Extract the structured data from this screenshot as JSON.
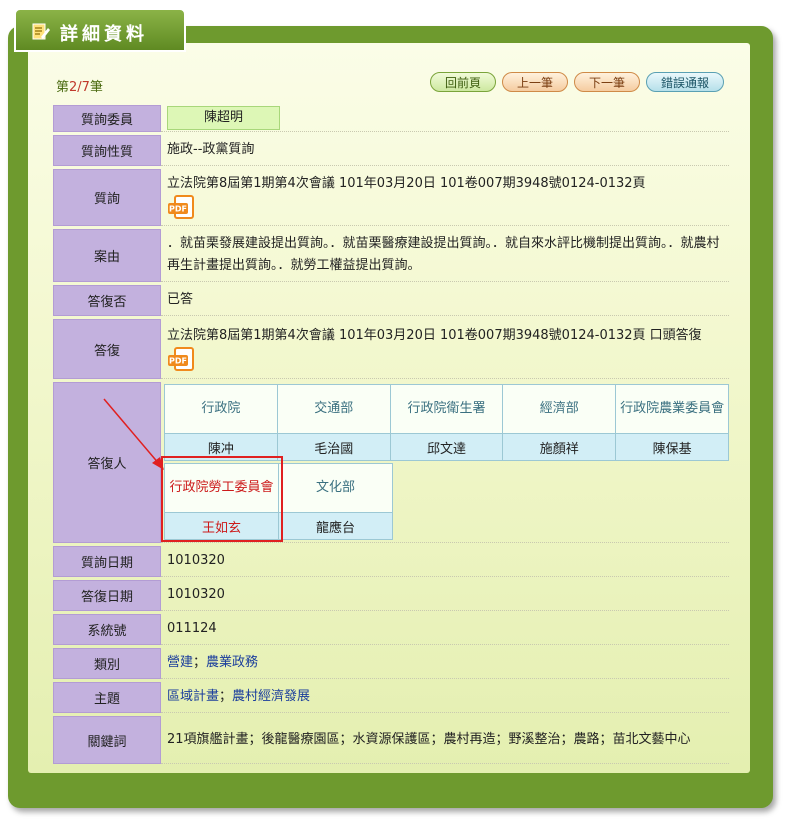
{
  "header": {
    "title": "詳細資料"
  },
  "nav": {
    "counter_prefix": "第",
    "counter_value": "2/7",
    "counter_suffix": "筆",
    "back_label": "回前頁",
    "prev_label": "上一筆",
    "next_label": "下一筆",
    "report_label": "錯誤通報"
  },
  "fields": {
    "member_label": "質詢委員",
    "member_value": "陳超明",
    "nature_label": "質詢性質",
    "nature_value": "施政--政黨質詢",
    "inquiry_label": "質詢",
    "inquiry_value": "立法院第8屆第1期第4次會議 101年03月20日 101卷007期3948號0124-0132頁",
    "reason_label": "案由",
    "reason_value": "．就苗栗發展建設提出質詢。．就苗栗醫療建設提出質詢。．就自來水評比機制提出質詢。．就農村再生計畫提出質詢。．就勞工權益提出質詢。",
    "replied_label": "答復否",
    "replied_value": "已答",
    "reply_label": "答復",
    "reply_value": "立法院第8屆第1期第4次會議 101年03月20日 101卷007期3948號0124-0132頁 口頭答復",
    "responder_label": "答復人",
    "inquiry_date_label": "質詢日期",
    "inquiry_date_value": "1010320",
    "reply_date_label": "答復日期",
    "reply_date_value": "1010320",
    "sysno_label": "系統號",
    "sysno_value": "011124",
    "category_label": "類別",
    "category_link1": "營建",
    "category_link2": "農業政務",
    "topic_label": "主題",
    "topic_link1": "區域計畫",
    "topic_link2": "農村經濟發展",
    "keyword_label": "關鍵詞",
    "keyword_value": "21項旗艦計畫；後龍醫療園區；水資源保護區；農村再造；野溪整治；農路；苗北文藝中心"
  },
  "pdf_icon_text": "PDF",
  "separator": "；",
  "responders_row1": [
    {
      "org": "行政院",
      "name": "陳冲"
    },
    {
      "org": "交通部",
      "name": "毛治國"
    },
    {
      "org": "行政院衛生署",
      "name": "邱文達"
    },
    {
      "org": "經濟部",
      "name": "施顏祥"
    },
    {
      "org": "行政院農業委員會",
      "name": "陳保基"
    }
  ],
  "responders_row2": [
    {
      "org": "行政院勞工委員會",
      "name": "王如玄"
    },
    {
      "org": "文化部",
      "name": "龍應台"
    }
  ],
  "colors": {
    "frame": "#6e9a2e",
    "label_bg": "#c3b1de",
    "highlight": "#e02020"
  }
}
